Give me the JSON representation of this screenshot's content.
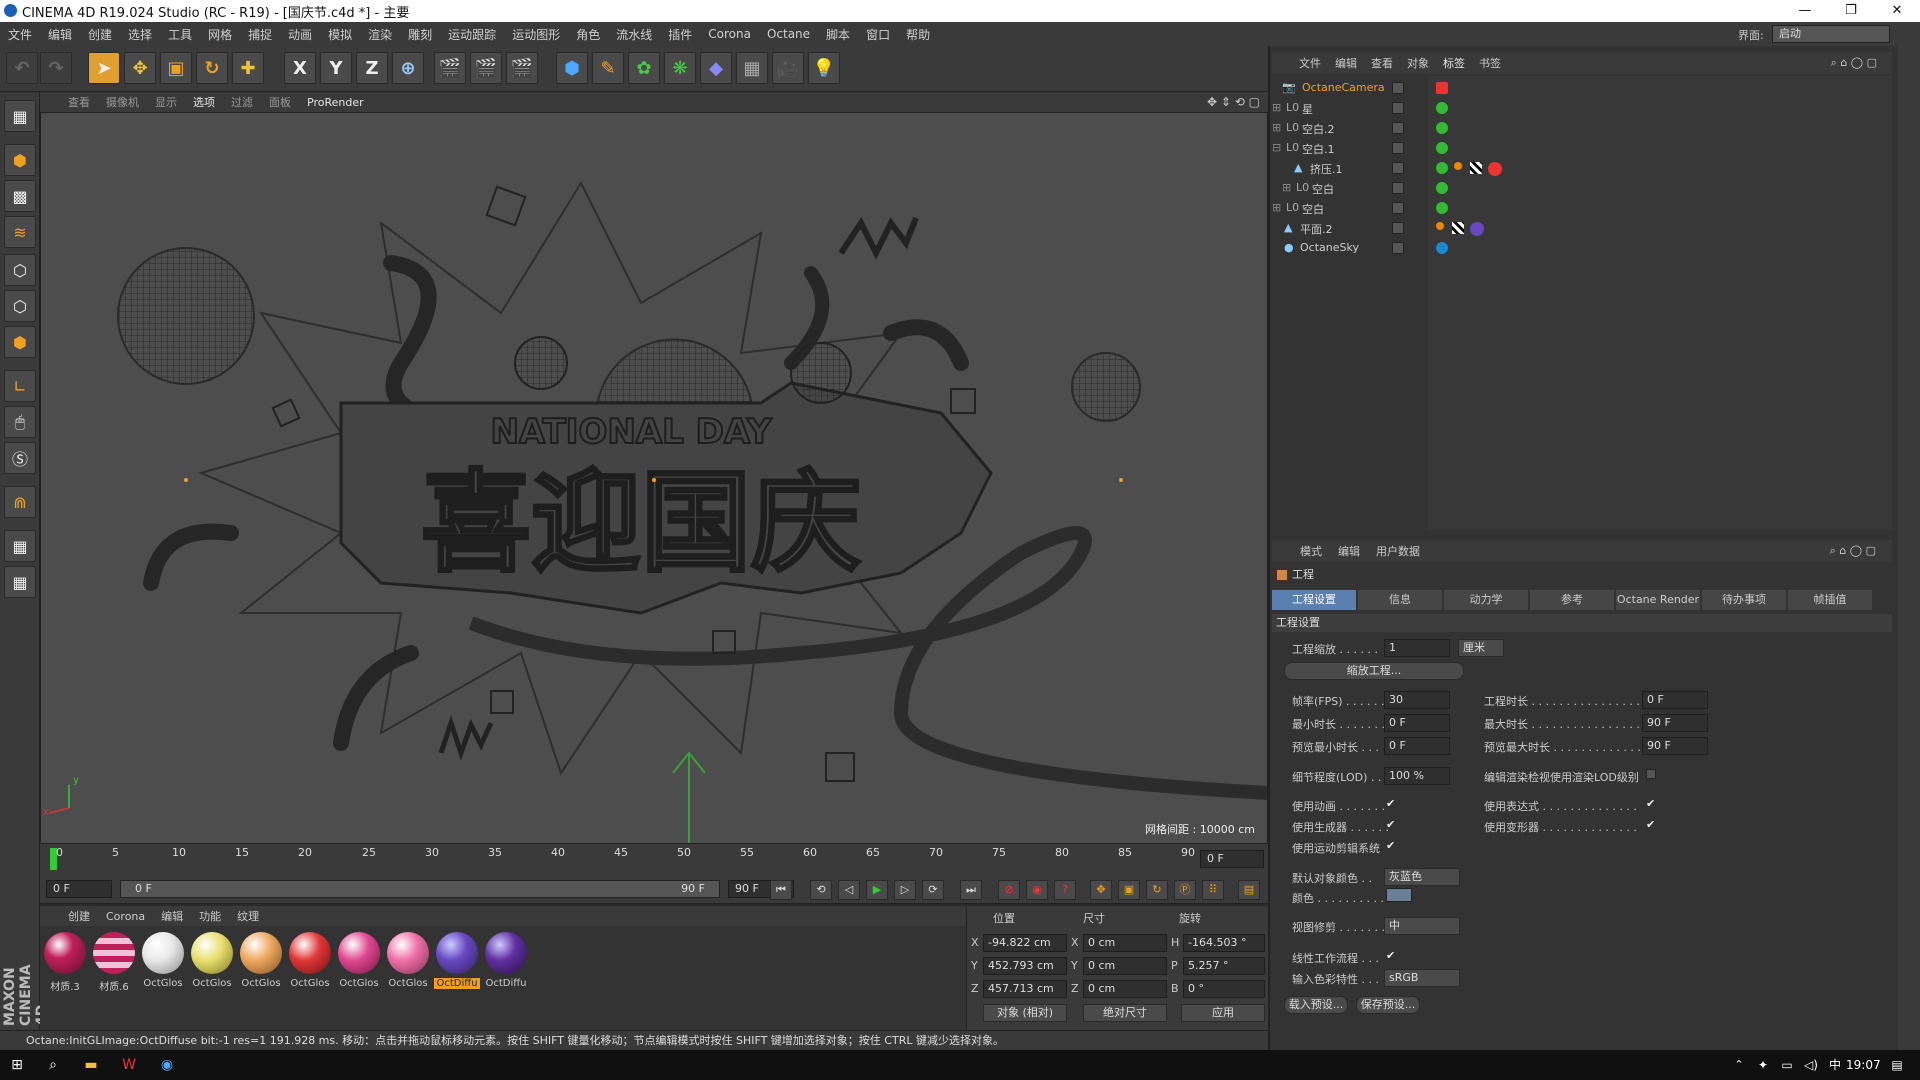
{
  "window": {
    "title": "CINEMA 4D R19.024 Studio (RC - R19) - [国庆节.c4d *] - 主要",
    "min": "—",
    "max": "❐",
    "close": "✕"
  },
  "menu": [
    "文件",
    "编辑",
    "创建",
    "选择",
    "工具",
    "网格",
    "捕捉",
    "动画",
    "模拟",
    "渲染",
    "雕刻",
    "运动跟踪",
    "运动图形",
    "角色",
    "流水线",
    "插件",
    "Corona",
    "Octane",
    "脚本",
    "窗口",
    "帮助"
  ],
  "interface": {
    "label": "界面:",
    "value": "启动"
  },
  "toolbar": {
    "x": "X",
    "y": "Y",
    "z": "Z"
  },
  "viewport": {
    "menu": [
      "查看",
      "摄像机",
      "显示",
      "选项",
      "过滤",
      "面板",
      "ProRender"
    ],
    "grid_label": "网格间距 : 10000 cm",
    "axis_y": "y",
    "axis_x": "x",
    "title_en": "NATIONAL DAY",
    "title_cn": "喜迎国庆"
  },
  "timeline": {
    "ticks": [
      "0",
      "5",
      "10",
      "15",
      "20",
      "25",
      "30",
      "35",
      "40",
      "45",
      "50",
      "55",
      "60",
      "65",
      "70",
      "75",
      "80",
      "85",
      "90"
    ],
    "current": "0 F"
  },
  "transport": {
    "start": "0 F",
    "range_start": "0 F",
    "range_end": "90 F",
    "end": "90 F"
  },
  "materials": {
    "menu": [
      "创建",
      "Corona",
      "编辑",
      "功能",
      "纹理"
    ],
    "items": [
      {
        "label": "材质.3",
        "color": "#c0205a"
      },
      {
        "label": "材质.6",
        "color": "#e080b0"
      },
      {
        "label": "OctGlos",
        "color": "#e8e8e8"
      },
      {
        "label": "OctGlos",
        "color": "#e8e070"
      },
      {
        "label": "OctGlos",
        "color": "#f0a860"
      },
      {
        "label": "OctGlos",
        "color": "#e03838"
      },
      {
        "label": "OctGlos",
        "color": "#e04890"
      },
      {
        "label": "OctGlos",
        "color": "#f070a8"
      },
      {
        "label": "OctDiffu",
        "color": "#6848c0"
      },
      {
        "label": "OctDiffu",
        "color": "#6030a0"
      }
    ]
  },
  "coords": {
    "pos": "位置",
    "size": "尺寸",
    "rot": "旋转",
    "x": "X",
    "y": "Y",
    "z": "Z",
    "h": "H",
    "p": "P",
    "b": "B",
    "px": "-94.822 cm",
    "py": "452.793 cm",
    "pz": "457.713 cm",
    "sx": "0 cm",
    "sy": "0 cm",
    "sz": "0 cm",
    "rh": "-164.503 °",
    "rp": "5.257 °",
    "rb": "0 °",
    "mode": "对象 (相对)",
    "sizemode": "绝对尺寸",
    "apply": "应用"
  },
  "status": {
    "text": "Octane:InitGLImage:OctDiffuse  bit:-1 res=1  191.928 ms.     移动：点击并拖动鼠标移动元素。按住 SHIFT 键量化移动；节点编辑模式时按住 SHIFT 键增加选择对象；按住 CTRL 键减少选择对象。"
  },
  "objects": {
    "menu": [
      "文件",
      "编辑",
      "查看",
      "对象",
      "标签",
      "书签"
    ],
    "rows": [
      {
        "name": "OctaneCamera",
        "icon": "📷"
      },
      {
        "name": "星",
        "icon": "L0"
      },
      {
        "name": "空白.2",
        "icon": "L0"
      },
      {
        "name": "空白.1",
        "icon": "L0"
      },
      {
        "name": "挤压.1",
        "icon": "▲"
      },
      {
        "name": "空白",
        "icon": "L0"
      },
      {
        "name": "空白",
        "icon": "L0"
      },
      {
        "name": "平面.2",
        "icon": "▲"
      },
      {
        "name": "OctaneSky",
        "icon": "●"
      }
    ]
  },
  "attributes": {
    "menu": [
      "模式",
      "编辑",
      "用户数据"
    ],
    "project": "工程",
    "tabs": [
      "工程设置",
      "信息",
      "动力学",
      "参考",
      "Octane Render",
      "待办事项",
      "帧插值"
    ],
    "section": "工程设置",
    "scale_label": "工程缩放 . . . . . .",
    "scale_value": "1",
    "scale_unit": "厘米",
    "scale_btn": "缩放工程...",
    "fps_label": "帧率(FPS) . . . . . .",
    "fps": "30",
    "ptime_label": "工程时长 . . . . . . . . . . . . . . . .",
    "ptime": "0 F",
    "mintime_label": "最小时长 . . . . . . .",
    "mintime": "0 F",
    "maxtime_label": "最大时长 . . . . . . . . . . . . . . . .",
    "maxtime": "90 F",
    "pmin_label": "预览最小时长 . . .",
    "pmin": "0 F",
    "pmax_label": "预览最大时长 . . . . . . . . . . . . .",
    "pmax": "90 F",
    "lod_label": "细节程度(LOD) . .",
    "lod": "100 %",
    "lod_cb_label": "编辑渲染检视使用渲染LOD级别",
    "anim_label": "使用动画 . . . . . . .",
    "expr_label": "使用表达式 . . . . . . . . . . . . . .",
    "gen_label": "使用生成器 . . . . . .",
    "deform_label": "使用变形器 . . . . . . . . . . . . . .",
    "mograph_label": "使用运动剪辑系统",
    "defcolor_label": "默认对象颜色 . .",
    "defcolor": "灰蓝色",
    "color_label": "颜色 . . . . . . . . . .",
    "clip_label": "视图修剪 . . . . . . .",
    "clip": "中",
    "linear_label": "线性工作流程 . . .",
    "inprofile_label": "输入色彩特性 . . .",
    "inprofile": "sRGB",
    "load_btn": "载入预设...",
    "save_btn": "保存预设..."
  },
  "taskbar": {
    "time": "19:07"
  },
  "colors": {
    "accent": "#f0a020",
    "tab_active": "#5a7fb0",
    "viewport": "#4d4d4d"
  }
}
